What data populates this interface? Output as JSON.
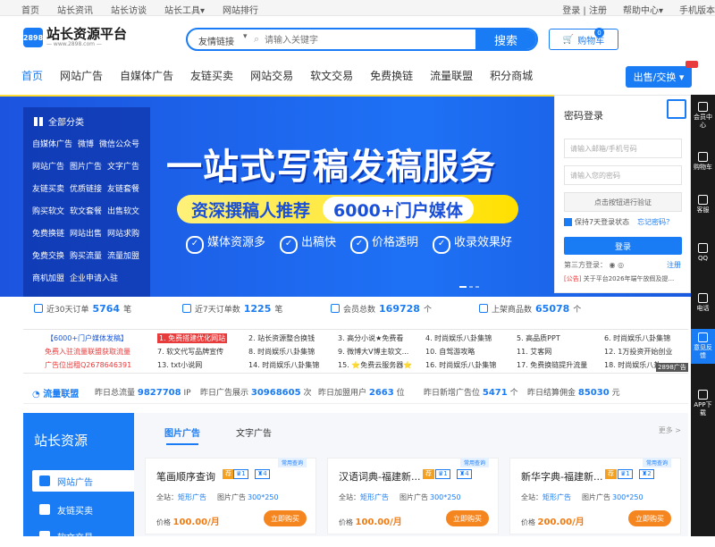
{
  "topbar": {
    "left_links": [
      "首页",
      "站长资讯",
      "站长访谈",
      "站长工具▾",
      "网站排行"
    ],
    "login_register": "登录 | 注册",
    "help": "帮助中心▾",
    "mobile": "手机版本"
  },
  "logo": {
    "mark": "2898",
    "name": "站长资源平台",
    "url_text": "— www.2898.com —"
  },
  "search": {
    "category": "友情链接",
    "placeholder": "请输入关键字",
    "button": "搜索"
  },
  "cart": {
    "label": "购物车",
    "count": "0"
  },
  "nav": {
    "items": [
      "首页",
      "网站广告",
      "自媒体广告",
      "友链买卖",
      "网站交易",
      "软文交易",
      "免费换链",
      "流量联盟",
      "积分商城"
    ],
    "sell_button": "出售/交换 ▾"
  },
  "categories": {
    "title": "全部分类",
    "rows": [
      [
        "自媒体广告",
        "微博",
        "微信公众号"
      ],
      [
        "网站广告",
        "图片广告",
        "文字广告"
      ],
      [
        "友链买卖",
        "优质链接",
        "友链套餐"
      ],
      [
        "购买软文",
        "软文套餐",
        "出售软文"
      ],
      [
        "免费换链",
        "网站出售",
        "网站求购"
      ],
      [
        "免费交换",
        "购买流量",
        "流量加盟"
      ],
      [
        "商机加盟",
        "企业申请入驻"
      ]
    ]
  },
  "banner": {
    "headline": "一站式写稿发稿服务",
    "pill_left": "资深撰稿人推荐",
    "pill_right": "6000+门户媒体",
    "features": [
      "媒体资源多",
      "出稿快",
      "价格透明",
      "收录效果好"
    ]
  },
  "login": {
    "title": "密码登录",
    "account_placeholder": "请输入邮箱/手机号码",
    "password_placeholder": "请输入您的密码",
    "verify": "点击按钮进行验证",
    "remember": "保持7天登录状态",
    "forgot": "忘记密码？",
    "button": "登录",
    "third_party": "第三方登录：",
    "register": "注册",
    "notice_tag": "[公告]",
    "notice": "关于平台2026年端午放假及提..."
  },
  "sidebar": {
    "items": [
      "会员中心",
      "购物车",
      "客服",
      "QQ",
      "电话",
      "意见反馈",
      "APP下载"
    ],
    "cart_count": "0"
  },
  "stats": [
    {
      "label": "近30天订单",
      "value": "5764",
      "unit": "笔"
    },
    {
      "label": "近7天订单数",
      "value": "1225",
      "unit": "笔"
    },
    {
      "label": "会员总数",
      "value": "169728",
      "unit": "个"
    },
    {
      "label": "上架商品数",
      "value": "65078",
      "unit": "个"
    }
  ],
  "ticker": {
    "col0": [
      "【6000+门户媒体发稿】",
      "免费入驻流量联盟获取流量",
      "广告位出租Q2678646391"
    ],
    "items": [
      [
        "1. 免费搭建优化网站",
        "2. 站长资源整合换钱",
        "3. 高分小说★免费看",
        "4. 时尚娱乐八卦集锦",
        "5. 高品质PPT",
        "6. 时尚娱乐八卦集锦"
      ],
      [
        "7. 软文代写品牌宣传",
        "8. 时尚娱乐八卦集锦",
        "9. 微博大V博主软文...",
        "10. 自驾游攻略",
        "11. 艾客网",
        "12. 1万投资开始创业"
      ],
      [
        "13. txt小说网",
        "14. 时尚娱乐八卦集锦",
        "15. ⭐免费云服务器⭐",
        "16. 时尚娱乐八卦集锦",
        "17. 免费换链提升流量",
        "18. 时尚娱乐八卦..."
      ]
    ],
    "watermark": "2898广告"
  },
  "flow": {
    "title": "流量联盟",
    "metrics": [
      {
        "label": "昨日总流量",
        "value": "9827708",
        "unit": "IP"
      },
      {
        "label": "昨日广告展示",
        "value": "30968605",
        "unit": "次"
      },
      {
        "label": "昨日加盟用户",
        "value": "2663",
        "unit": "位"
      },
      {
        "label": "昨日新增广告位",
        "value": "5471",
        "unit": "个"
      },
      {
        "label": "昨日结算佣金",
        "value": "85030",
        "unit": "元"
      }
    ]
  },
  "resources": {
    "title": "站长资源",
    "menu": [
      "网站广告",
      "友链买卖",
      "软文交易"
    ],
    "tabs": [
      "图片广告",
      "文字广告"
    ],
    "more": "更多 >",
    "cards": [
      {
        "tag": "常用查询",
        "name": "笔画顺序查询",
        "b1": "1",
        "b2": "4",
        "site_label": "全站：",
        "site": "矩形广告",
        "type": "图片广告",
        "size": "300*250",
        "price_label": "价格 ",
        "price": "100.00/月",
        "buy": "立即购买"
      },
      {
        "tag": "常用查询",
        "name": "汉语词典-福建新...",
        "b1": "1",
        "b2": "4",
        "site_label": "全站：",
        "site": "矩形广告",
        "type": "图片广告",
        "size": "300*250",
        "price_label": "价格 ",
        "price": "100.00/月",
        "buy": "立即购买"
      },
      {
        "tag": "常用查询",
        "name": "新华字典-福建新...",
        "b1": "1",
        "b2": "2",
        "site_label": "全站：",
        "site": "矩形广告",
        "type": "图片广告",
        "size": "300*250",
        "price_label": "价格 ",
        "price": "200.00/月",
        "buy": "立即购买"
      }
    ]
  }
}
